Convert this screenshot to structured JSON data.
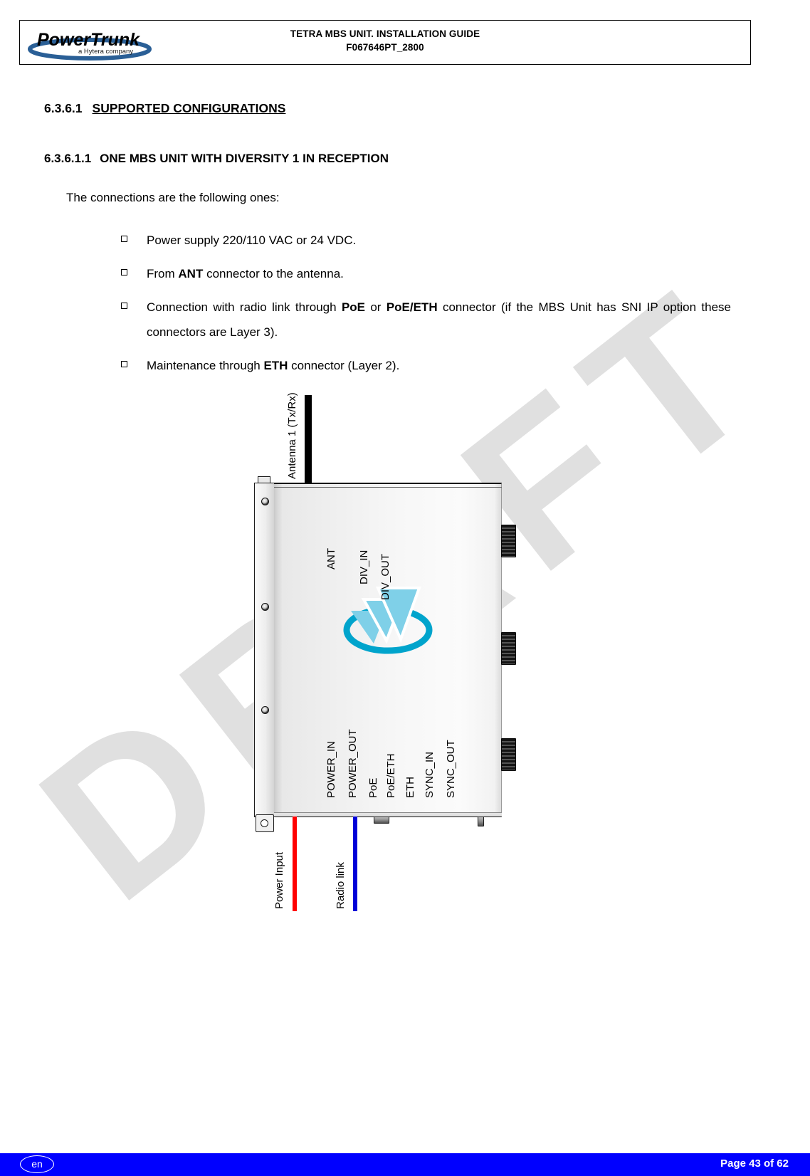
{
  "header": {
    "logo_name": "PowerTrunk",
    "logo_tagline": "a Hytera company",
    "title_line1": "TETRA MBS UNIT. INSTALLATION GUIDE",
    "title_line2": "F067646PT_2800"
  },
  "watermark": {
    "text": "DRAFT"
  },
  "sections": {
    "section_number": "6.3.6.1",
    "section_title": "SUPPORTED CONFIGURATIONS",
    "subsection_number": "6.3.6.1.1",
    "subsection_title": "ONE MBS UNIT WITH DIVERSITY 1 IN RECEPTION"
  },
  "body": {
    "intro": "The connections are the following ones:",
    "bullets": [
      {
        "parts": [
          {
            "text": "Power supply 220/110 VAC or 24 VDC.",
            "bold": false
          }
        ]
      },
      {
        "parts": [
          {
            "text": "From ",
            "bold": false
          },
          {
            "text": "ANT",
            "bold": true
          },
          {
            "text": " connector to the antenna.",
            "bold": false
          }
        ]
      },
      {
        "parts": [
          {
            "text": "Connection with radio link through ",
            "bold": false
          },
          {
            "text": "PoE",
            "bold": true
          },
          {
            "text": " or ",
            "bold": false
          },
          {
            "text": "PoE/ETH",
            "bold": true
          },
          {
            "text": " connector (if the MBS Unit has SNI IP option these connectors are Layer 3).",
            "bold": false
          }
        ]
      },
      {
        "parts": [
          {
            "text": "Maintenance through ",
            "bold": false
          },
          {
            "text": "ETH",
            "bold": true
          },
          {
            "text": " connector (Layer 2).",
            "bold": false
          }
        ]
      }
    ]
  },
  "diagram": {
    "antenna_label": "Antenna 1 (Tx/Rx)",
    "top_ports": [
      "ANT",
      "DIV_IN",
      "DIV_OUT"
    ],
    "bottom_ports": [
      "POWER_IN",
      "POWER_OUT",
      "PoE",
      "PoE/ETH",
      "ETH",
      "SYNC_IN",
      "SYNC_OUT"
    ],
    "cables": [
      {
        "label": "Power Input",
        "color": "#ff0000"
      },
      {
        "label": "Radio link",
        "color": "#0000d8"
      }
    ],
    "colors": {
      "logo_ellipse": "#00a4cc",
      "logo_triangles": "#7fd0e8"
    }
  },
  "footer": {
    "language": "en",
    "page": "Page 43 of 62",
    "bar_color": "#0000ff"
  }
}
